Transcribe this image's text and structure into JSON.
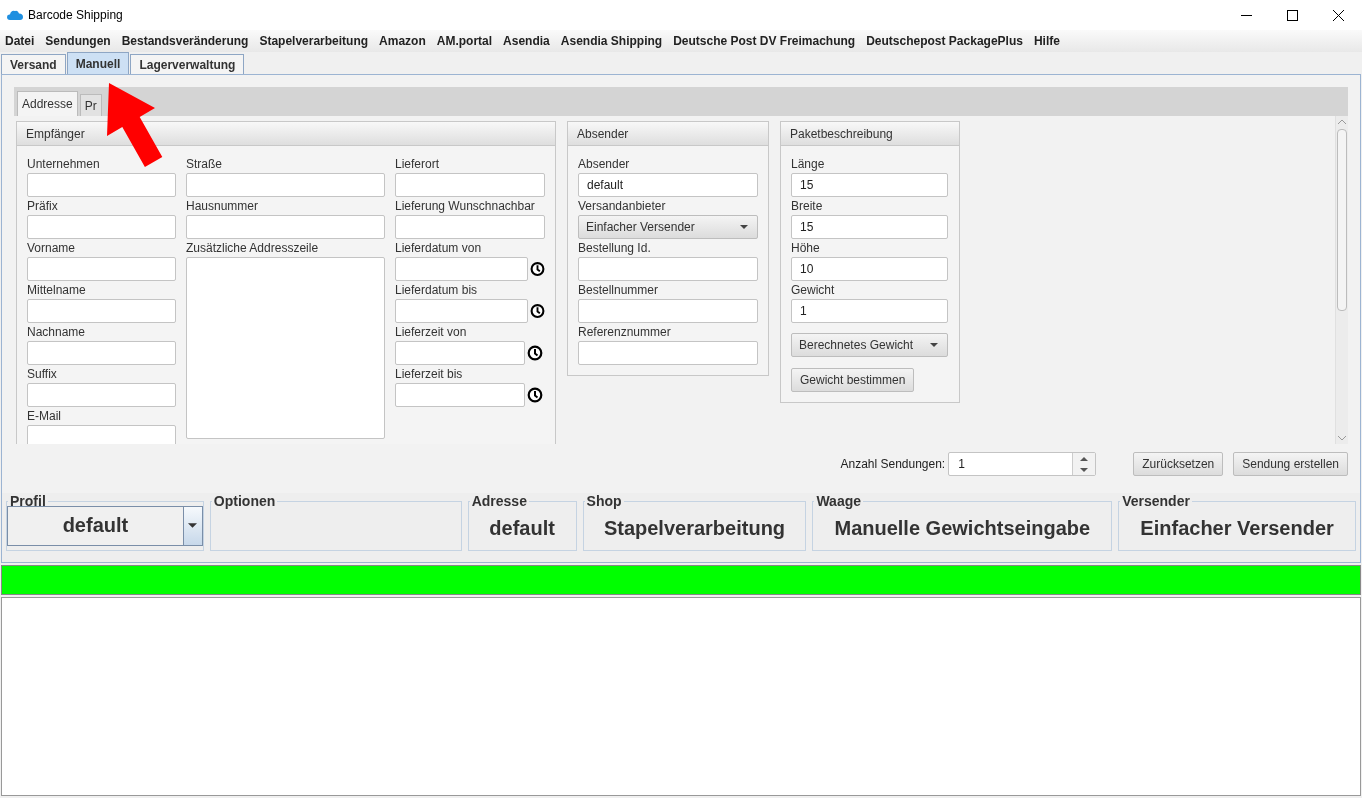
{
  "window": {
    "title": "Barcode Shipping"
  },
  "menu": [
    "Datei",
    "Sendungen",
    "Bestandsveränderung",
    "Stapelverarbeitung",
    "Amazon",
    "AM.portal",
    "Asendia",
    "Asendia Shipping",
    "Deutsche Post DV Freimachung",
    "Deutschepost PackagePlus",
    "Hilfe"
  ],
  "tabs": [
    {
      "label": "Versand",
      "selected": false
    },
    {
      "label": "Manuell",
      "selected": true
    },
    {
      "label": "Lagerverwaltung",
      "selected": false
    }
  ],
  "sub_tabs": [
    {
      "label": "Addresse",
      "selected": true
    },
    {
      "label": "Pr",
      "selected": false
    }
  ],
  "recipient": {
    "title": "Empfänger",
    "columns": [
      [
        {
          "label": "Unternehmen",
          "kind": "text"
        },
        {
          "label": "Präfix",
          "kind": "text"
        },
        {
          "label": "Vorname",
          "kind": "text"
        },
        {
          "label": "Mittelname",
          "kind": "text"
        },
        {
          "label": "Nachname",
          "kind": "text"
        },
        {
          "label": "Suffix",
          "kind": "text"
        },
        {
          "label": "E-Mail",
          "kind": "text"
        }
      ],
      [
        {
          "label": "Straße",
          "kind": "text"
        },
        {
          "label": "Hausnummer",
          "kind": "text"
        },
        {
          "label": "Zusätzliche Addresszeile",
          "kind": "textarea"
        }
      ],
      [
        {
          "label": "Lieferort",
          "kind": "text"
        },
        {
          "label": "Lieferung Wunschnachbar",
          "kind": "text"
        },
        {
          "label": "Lieferdatum von",
          "kind": "date"
        },
        {
          "label": "Lieferdatum bis",
          "kind": "date"
        },
        {
          "label": "Lieferzeit von",
          "kind": "time"
        },
        {
          "label": "Lieferzeit bis",
          "kind": "time"
        }
      ]
    ]
  },
  "sender": {
    "title": "Absender",
    "fields": [
      {
        "label": "Absender",
        "kind": "text",
        "value": "default"
      },
      {
        "label": "Versandanbieter",
        "kind": "select",
        "value": "Einfacher Versender"
      },
      {
        "label": "Bestellung Id.",
        "kind": "text"
      },
      {
        "label": "Bestellnummer",
        "kind": "text"
      },
      {
        "label": "Referenznummer",
        "kind": "text"
      }
    ]
  },
  "package": {
    "title": "Paketbeschreibung",
    "fields": [
      {
        "label": "Länge",
        "kind": "text",
        "value": "15"
      },
      {
        "label": "Breite",
        "kind": "text",
        "value": "15"
      },
      {
        "label": "Höhe",
        "kind": "text",
        "value": "10"
      },
      {
        "label": "Gewicht",
        "kind": "text",
        "value": "1"
      }
    ],
    "weight_mode": "Berechnetes Gewicht",
    "button": "Gewicht bestimmen"
  },
  "count": {
    "label": "Anzahl Sendungen:",
    "value": "1"
  },
  "buttons": [
    "Zurücksetzen",
    "Sendung erstellen"
  ],
  "status_panels": [
    {
      "title": "Profil",
      "kind": "select",
      "value": "default"
    },
    {
      "title": "Optionen",
      "kind": "empty"
    },
    {
      "title": "Adresse",
      "kind": "text",
      "value": "default"
    },
    {
      "title": "Shop",
      "kind": "text",
      "value": "Stapelverarbeitung"
    },
    {
      "title": "Waage",
      "kind": "text",
      "value": "Manuelle Gewichtseingabe"
    },
    {
      "title": "Versender",
      "kind": "text",
      "value": "Einfacher Versender"
    }
  ],
  "progress": {
    "level": 1
  }
}
